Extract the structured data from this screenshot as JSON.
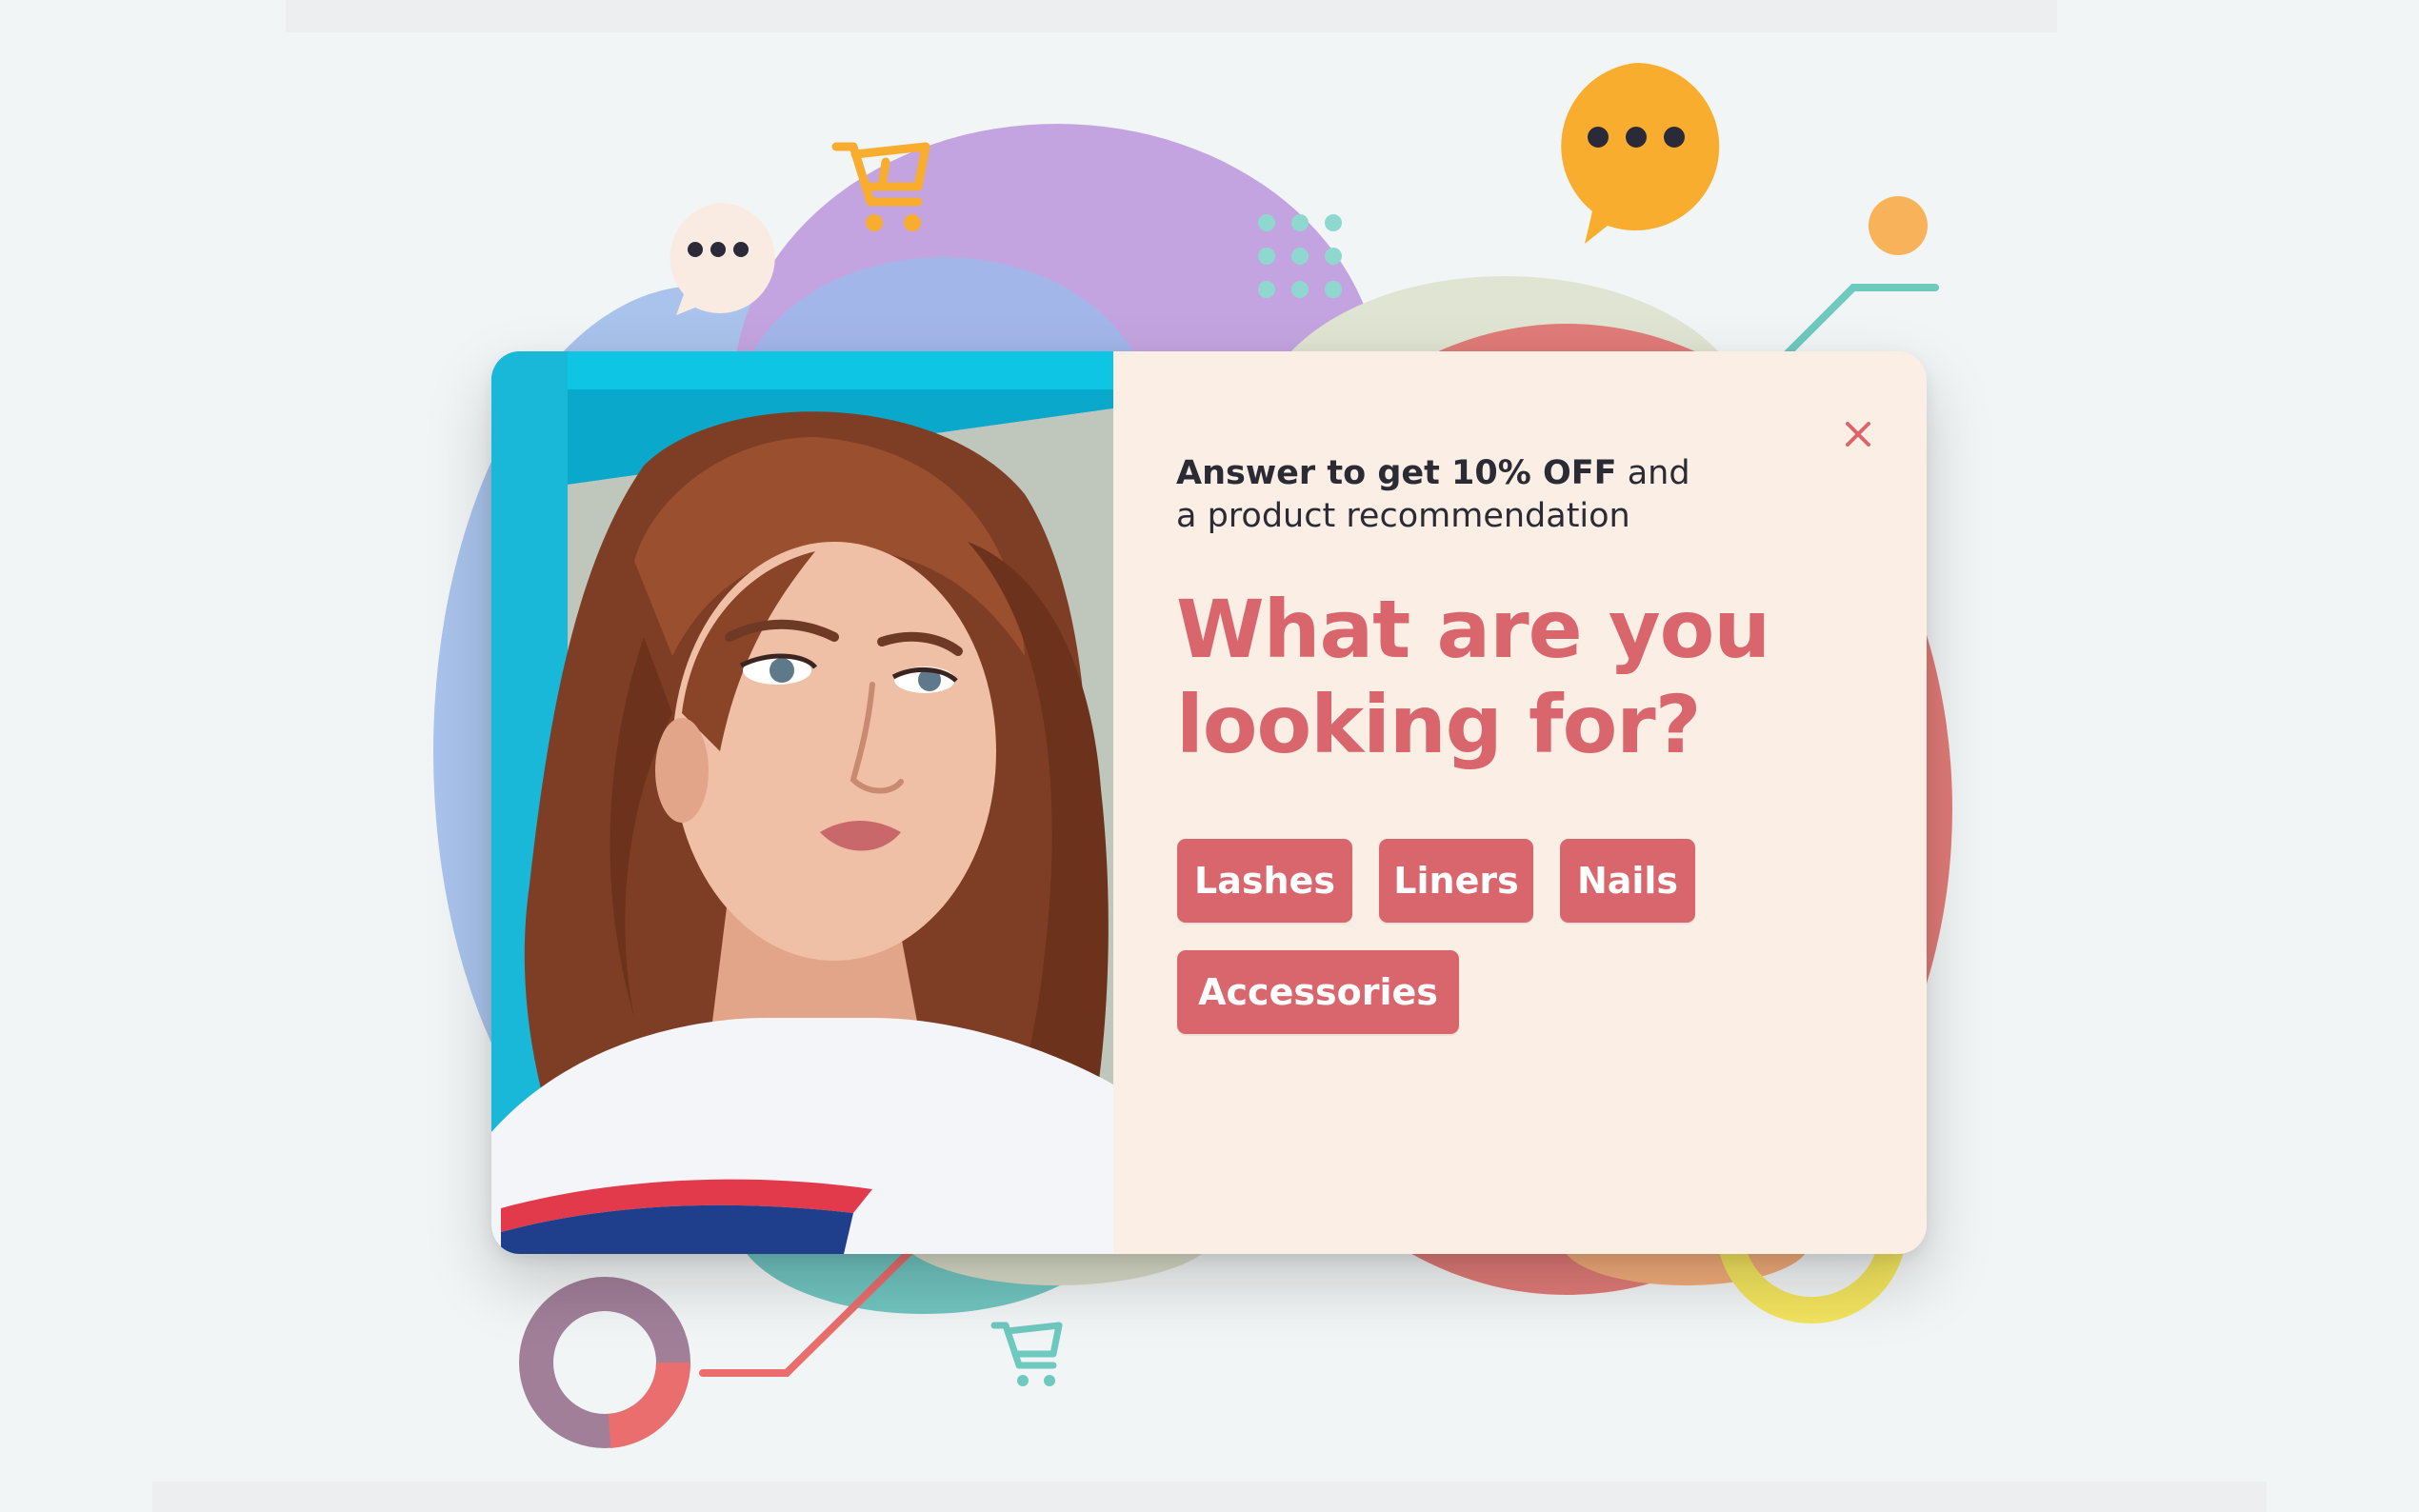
{
  "popup": {
    "subtitle_bold": "Answer to get 10% OFF",
    "subtitle_rest": " and",
    "subtitle_line2": "a product recommendation",
    "headline_line1": "What are you",
    "headline_line2": "looking for?",
    "close_icon": "close-icon",
    "options": [
      "Lashes",
      "Liners",
      "Nails",
      "Accessories"
    ]
  },
  "decorations": {
    "icons": [
      "chat-bubble-icon",
      "chat-bubble-icon",
      "shopping-cart-icon",
      "shopping-cart-icon",
      "dot-grid-icon"
    ]
  },
  "colors": {
    "accent": "#d9666c",
    "panel_background": "#faeee5",
    "page_background": "#f2f5f5",
    "heading_text": "#2b2b35",
    "chat_orange": "#f8ad2e",
    "blob_purple": "#c4a4e0",
    "blob_blue": "#a3b6ea",
    "blob_teal": "#71c5c0",
    "ring_yellow": "#f3e55e",
    "ring_mauve": "#a17f99"
  }
}
